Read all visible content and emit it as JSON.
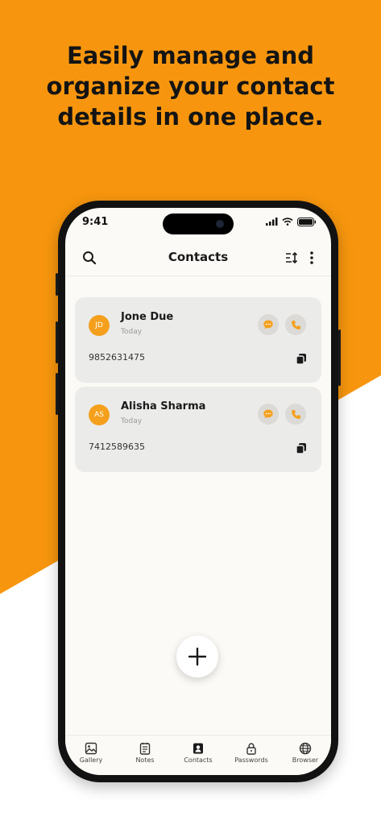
{
  "headline": "Easily manage and\norganize your contact\ndetails in one place.",
  "status": {
    "time": "9:41"
  },
  "appbar": {
    "title": "Contacts"
  },
  "contacts": [
    {
      "initials": "JD",
      "name": "Jone Due",
      "date": "Today",
      "phone": "9852631475"
    },
    {
      "initials": "AS",
      "name": "Alisha Sharma",
      "date": "Today",
      "phone": "7412589635"
    }
  ],
  "bottom_nav": [
    {
      "label": "Gallery",
      "icon": "gallery-icon"
    },
    {
      "label": "Notes",
      "icon": "notes-icon"
    },
    {
      "label": "Contacts",
      "icon": "contacts-icon",
      "active": true
    },
    {
      "label": "Passwords",
      "icon": "lock-icon"
    },
    {
      "label": "Browser",
      "icon": "globe-icon"
    }
  ],
  "colors": {
    "accent": "#F7960E",
    "avatar": "#F5A01C",
    "card": "#EBEBEA",
    "screen": "#FCFAF6"
  }
}
